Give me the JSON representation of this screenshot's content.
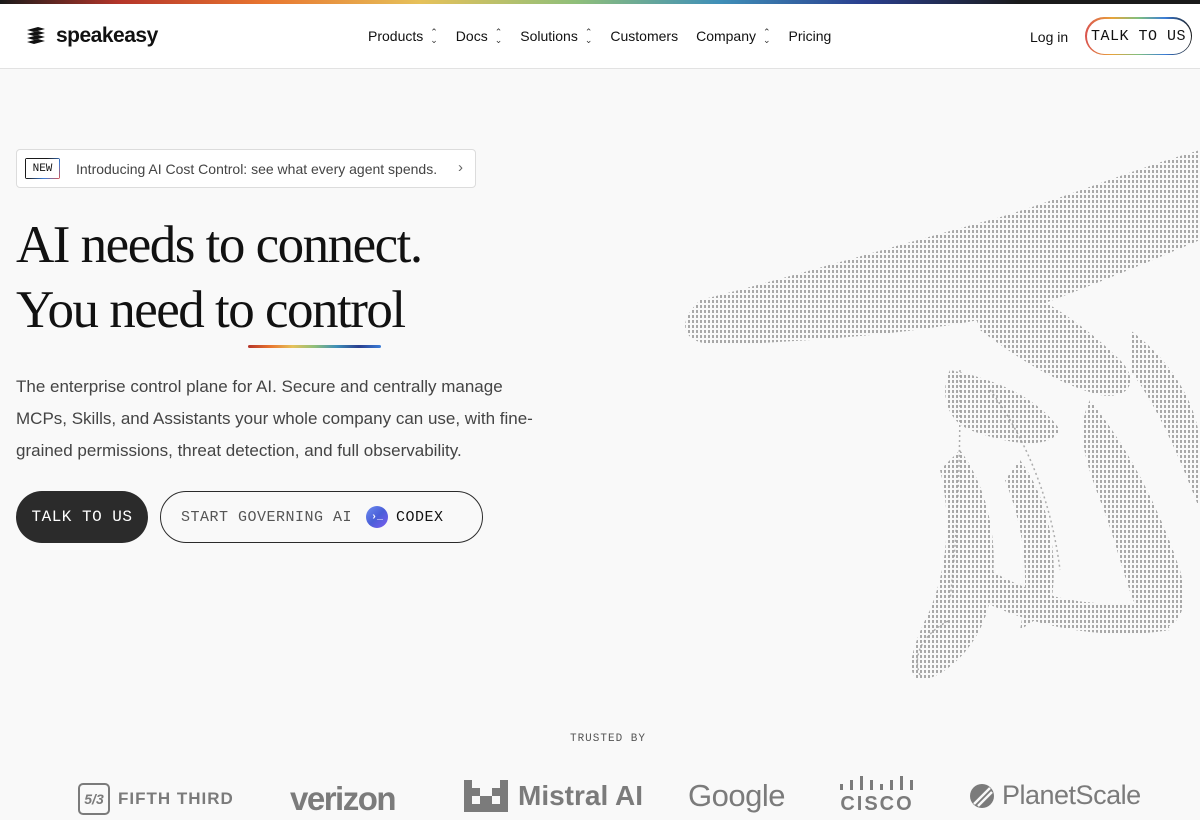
{
  "brand": {
    "name": "speakeasy"
  },
  "nav": {
    "items": [
      {
        "label": "Products",
        "has_menu": true
      },
      {
        "label": "Docs",
        "has_menu": true
      },
      {
        "label": "Solutions",
        "has_menu": true
      },
      {
        "label": "Customers",
        "has_menu": false
      },
      {
        "label": "Company",
        "has_menu": true
      },
      {
        "label": "Pricing",
        "has_menu": false
      }
    ],
    "login_label": "Log in",
    "cta_label": "TALK TO US"
  },
  "announcement": {
    "badge": "NEW",
    "text": "Introducing AI Cost Control: see what every agent spends."
  },
  "hero": {
    "headline_line1": "AI needs to connect.",
    "headline_line2": "You need to control",
    "description": "The enterprise control plane for AI. Secure and centrally manage MCPs, Skills, and Assistants your whole company can use, with fine-grained permissions, threat detection, and full observability.",
    "primary_cta": "TALK TO US",
    "secondary_cta": "START GOVERNING AI",
    "secondary_cta_product": "CODEX"
  },
  "trusted": {
    "label": "TRUSTED BY",
    "logos": [
      "FIFTH THIRD",
      "verizon",
      "Mistral AI",
      "Google",
      "CISCO",
      "PlanetScale"
    ]
  },
  "colors": {
    "background": "#f9f9f9",
    "dark_button": "#2b2b2b",
    "logo_gray": "#7b7b7b"
  }
}
